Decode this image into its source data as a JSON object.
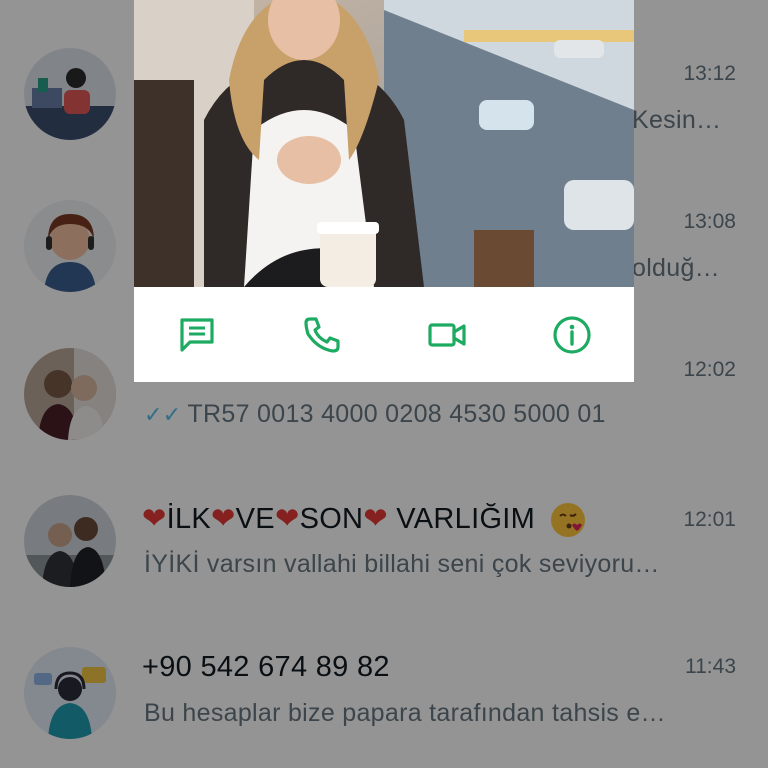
{
  "colors": {
    "accent": "#1daa61",
    "name_text": "#111b21",
    "secondary_text": "#667781",
    "read_ticks": "#53bdeb",
    "overlay": "rgba(0,0,0,0.42)"
  },
  "chats": [
    {
      "name": "",
      "time": "13:12",
      "preview": "Kesin…",
      "avatar": "office-illustration-avatar"
    },
    {
      "name": "",
      "time": "13:08",
      "preview": "olduğ…",
      "avatar": "support-agent-avatar"
    },
    {
      "name": "",
      "time": "12:02",
      "preview": "TR57 0013 4000 0208 4530 5000 01",
      "ticks": "✓✓",
      "avatar": "couple-photo-avatar"
    },
    {
      "name_parts": [
        "❤",
        "İLK",
        "❤",
        "VE",
        "❤",
        "SON",
        "❤",
        " VARLIĞIM"
      ],
      "time": "12:01",
      "preview": "İYİKİ varsın vallahi billahi seni çok seviyoru…",
      "avatar": "couple-outdoor-avatar",
      "emoji": "kissing-face-emoji"
    },
    {
      "name": "+90 542 674 89 82",
      "time": "11:43",
      "preview": "Bu hesaplar bize papara tarafından tahsis e…",
      "avatar": "headset-illustration-avatar"
    }
  ],
  "popup": {
    "photo": "profile-photo",
    "actions": [
      {
        "icon": "message-icon"
      },
      {
        "icon": "phone-icon"
      },
      {
        "icon": "video-call-icon"
      },
      {
        "icon": "info-icon"
      }
    ]
  }
}
